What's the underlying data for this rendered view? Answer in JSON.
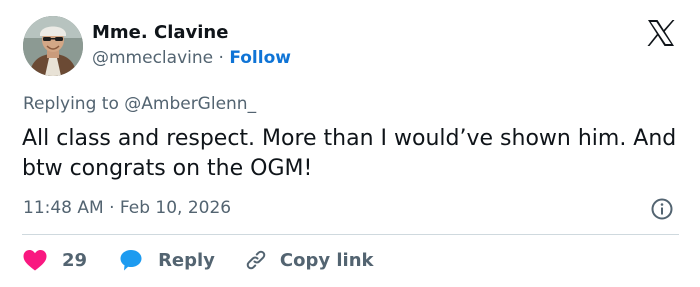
{
  "tweet": {
    "author": {
      "name": "Mme. Clavine",
      "handle": "@mmeclavine",
      "separator": "·",
      "follow_label": "Follow"
    },
    "reply_to": {
      "prefix": "Replying to",
      "handle": "@AmberGlenn_"
    },
    "text": "All class and respect. More than I would’ve shown him. And btw congrats on the OGM!",
    "timestamp": "11:48 AM · Feb 10, 2026"
  },
  "actions": {
    "like_count": "29",
    "reply_label": "Reply",
    "copy_link_label": "Copy link"
  },
  "icons": {
    "brand": "x-logo-icon",
    "info": "info-icon",
    "like": "heart-icon",
    "reply": "speech-bubble-icon",
    "copy_link": "link-icon"
  },
  "colors": {
    "text": "#0f1419",
    "secondary_text": "#536471",
    "link": "#0f74d6",
    "like": "#f91880",
    "reply": "#1d9bf0",
    "divider": "#cfd9de"
  }
}
